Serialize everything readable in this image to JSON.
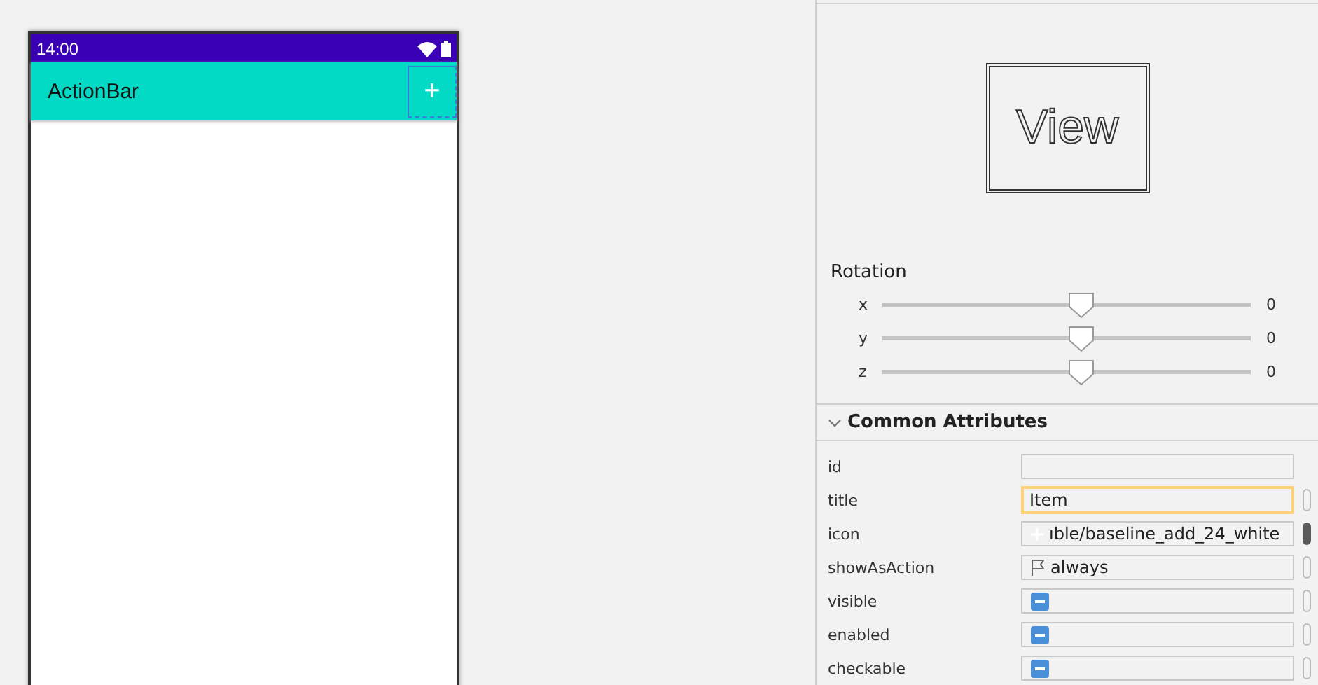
{
  "phone": {
    "status_bar": {
      "time": "14:00"
    },
    "action_bar": {
      "title": "ActionBar",
      "action_icon": "+",
      "action_selected": true
    }
  },
  "preview": {
    "label": "View"
  },
  "rotation": {
    "title": "Rotation",
    "axes": [
      {
        "name": "x",
        "level": 0.5,
        "reading": "0"
      },
      {
        "name": "y",
        "level": 0.5,
        "reading": "0"
      },
      {
        "name": "z",
        "level": 0.5,
        "reading": "0"
      }
    ]
  },
  "common_attributes": {
    "title": "Common Attributes",
    "expanded": true,
    "rows": [
      {
        "name": "id",
        "kind": "text",
        "value": "",
        "focused": false,
        "has_indicator": false
      },
      {
        "name": "title",
        "kind": "text",
        "value": "Item",
        "focused": true,
        "has_indicator": true,
        "indicator_filled": false
      },
      {
        "name": "icon",
        "kind": "icon",
        "value": "ıble/baseline_add_24_white",
        "focused": false,
        "has_indicator": true,
        "indicator_filled": true
      },
      {
        "name": "showAsAction",
        "kind": "flag",
        "value": "always",
        "focused": false,
        "has_indicator": true,
        "indicator_filled": false
      },
      {
        "name": "visible",
        "kind": "checkbox",
        "indeterminate": true,
        "focused": false,
        "has_indicator": true,
        "indicator_filled": false
      },
      {
        "name": "enabled",
        "kind": "checkbox",
        "indeterminate": true,
        "focused": false,
        "has_indicator": true,
        "indicator_filled": false
      },
      {
        "name": "checkable",
        "kind": "checkbox",
        "indeterminate": true,
        "focused": false,
        "has_indicator": true,
        "indicator_filled": false
      }
    ]
  }
}
